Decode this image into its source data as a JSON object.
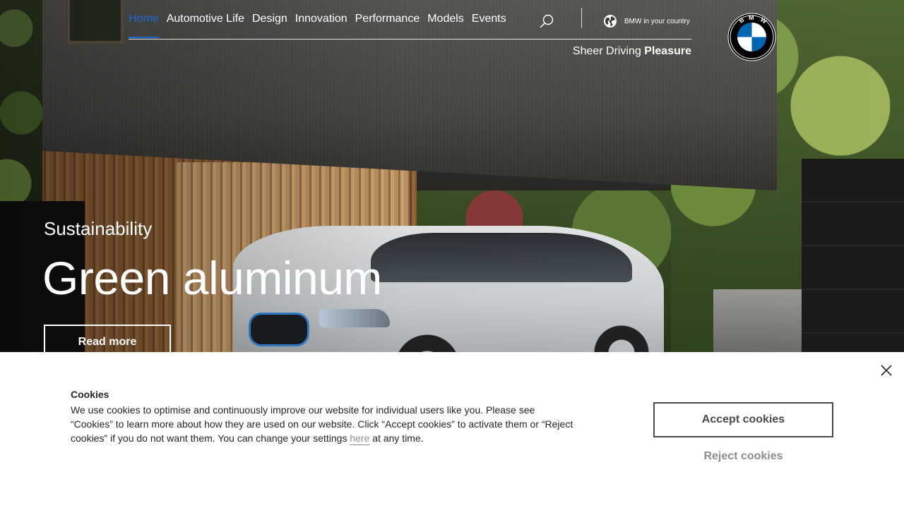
{
  "nav": {
    "items": [
      {
        "label": "Home",
        "active": true
      },
      {
        "label": "Automotive Life"
      },
      {
        "label": "Design"
      },
      {
        "label": "Innovation"
      },
      {
        "label": "Performance"
      },
      {
        "label": "Models"
      },
      {
        "label": "Events"
      }
    ],
    "search_icon": "search-icon",
    "country_label": "BMW in your country",
    "country_icon": "globe-icon",
    "tagline_regular": "Sheer Driving ",
    "tagline_bold": "Pleasure",
    "logo": "bmw-logo",
    "active_color": "#1c69d4"
  },
  "hero": {
    "kicker": "Sustainability",
    "title": "Green aluminum",
    "cta_label": "Read more"
  },
  "cookie": {
    "title": "Cookies",
    "text_before_link": "We use cookies to optimise and continuously improve our website for individual users like you. Please see “Cookies” to learn more about how they are used on our website. Click “Accept cookies” to activate them or “Reject cookies” if you do not want them. You can change your settings ",
    "link_label": "here",
    "text_after_link": " at any time.",
    "accept_label": "Accept cookies",
    "reject_label": "Reject cookies",
    "close_icon": "close-icon"
  }
}
